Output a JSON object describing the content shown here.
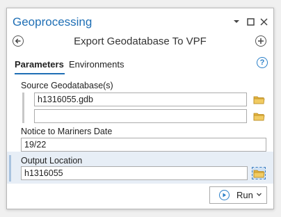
{
  "pane": {
    "title": "Geoprocessing"
  },
  "tool": {
    "title": "Export Geodatabase To VPF"
  },
  "tabs": [
    {
      "label": "Parameters",
      "active": true
    },
    {
      "label": "Environments",
      "active": false
    }
  ],
  "help": {
    "glyph": "?"
  },
  "params": {
    "source": {
      "label": "Source Geodatabase(s)",
      "values": [
        "h1316055.gdb",
        ""
      ]
    },
    "notice": {
      "label": "Notice to Mariners Date",
      "value": "19/22"
    },
    "output": {
      "label": "Output Location",
      "value": "h1316055"
    }
  },
  "run": {
    "label": "Run"
  },
  "colors": {
    "accent": "#1f6fb5",
    "folder": "#e2b340"
  },
  "icons": [
    "back-arrow-icon",
    "add-icon",
    "help-icon",
    "folder-icon",
    "run-icon",
    "chevron-down-icon",
    "menu-down-icon",
    "maximize-icon",
    "close-icon"
  ]
}
